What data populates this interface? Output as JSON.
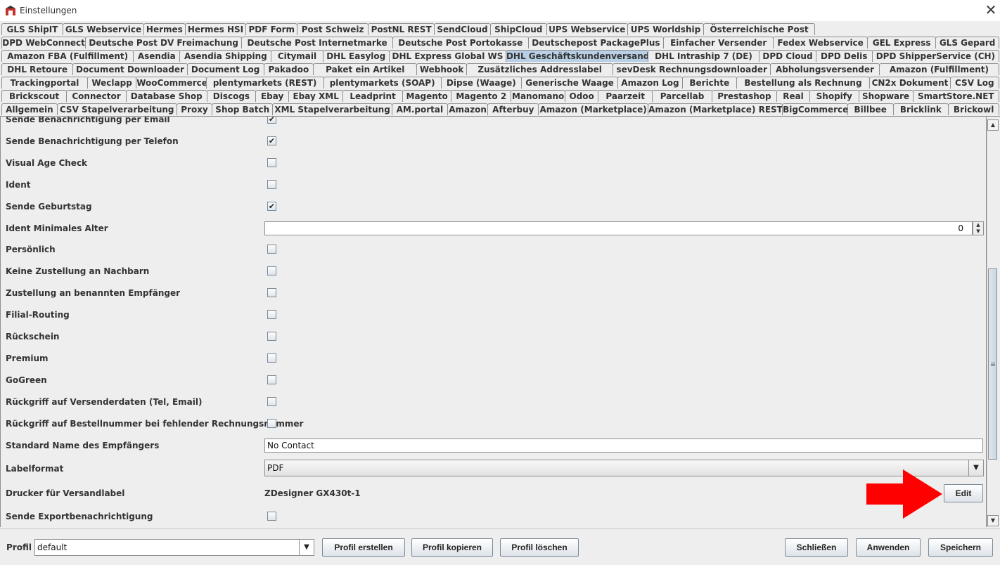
{
  "window": {
    "title": "Einstellungen",
    "close_symbol": "✕",
    "app_icon": "app-icon"
  },
  "tab_rows": [
    [
      "GLS ShipIT",
      "GLS Webservice",
      "Hermes",
      "Hermes HSI",
      "PDF Form",
      "Post Schweiz",
      "PostNL REST",
      "SendCloud",
      "ShipCloud",
      "UPS Webservice",
      "UPS Worldship",
      "Österreichische Post"
    ],
    [
      "DPD WebConnect",
      "Deutsche Post DV Freimachung",
      "Deutsche Post Internetmarke",
      "Deutsche Post Portokasse",
      "Deutschepost PackagePlus",
      "Einfacher Versender",
      "Fedex Webservice",
      "GEL Express",
      "GLS Gepard"
    ],
    [
      "Amazon FBA (Fulfillment)",
      "Asendia",
      "Asendia Shipping",
      "Citymail",
      "DHL Easylog",
      "DHL Express Global WS",
      "DHL Geschäftskundenversand",
      "DHL Intraship 7 (DE)",
      "DPD Cloud",
      "DPD Delis",
      "DPD ShipperService (CH)"
    ],
    [
      "DHL Retoure",
      "Document Downloader",
      "Document Log",
      "Pakadoo",
      "Paket ein Artikel",
      "Webhook",
      "Zusätzliches Addresslabel",
      "sevDesk Rechnungsdownloader",
      "Abholungsversender",
      "Amazon (Fulfillment)"
    ],
    [
      "Trackingportal",
      "Weclapp",
      "WooCommerce",
      "plentymarkets (REST)",
      "plentymarkets (SOAP)",
      "Dipse (Waage)",
      "Generische Waage",
      "Amazon Log",
      "Berichte",
      "Bestellung als Rechnung",
      "CN2x Dokument",
      "CSV Log"
    ],
    [
      "Brickscout",
      "Connector",
      "Database Shop",
      "Discogs",
      "Ebay",
      "Ebay XML",
      "Leadprint",
      "Magento",
      "Magento 2",
      "Manomano",
      "Odoo",
      "Paarzeit",
      "Parcellab",
      "Prestashop",
      "Real",
      "Shopify",
      "Shopware",
      "SmartStore.NET"
    ],
    [
      "Allgemein",
      "CSV Stapelverarbeitung",
      "Proxy",
      "Shop Batch",
      "XML Stapelverarbeitung",
      "AM.portal",
      "Amazon",
      "Afterbuy",
      "Amazon (Marketplace)",
      "Amazon (Marketplace) REST",
      "BigCommerce",
      "Billbee",
      "Bricklink",
      "Brickowl"
    ]
  ],
  "selected_tab": "DHL Geschäftskundenversand",
  "settings": {
    "partial_top": {
      "label": "Sende Benachrichtigung per Email",
      "checked": "✔"
    },
    "sende_telefon": {
      "label": "Sende Benachrichtigung per Telefon",
      "checked": "✔"
    },
    "visual_age_check": {
      "label": "Visual Age Check",
      "checked": ""
    },
    "ident": {
      "label": "Ident",
      "checked": ""
    },
    "sende_geburtstag": {
      "label": "Sende Geburtstag",
      "checked": "✔"
    },
    "ident_min_alter": {
      "label": "Ident Minimales Alter",
      "value": "0"
    },
    "persoenlich": {
      "label": "Persönlich",
      "checked": ""
    },
    "keine_zustellung": {
      "label": "Keine Zustellung an Nachbarn",
      "checked": ""
    },
    "zustellung_benannt": {
      "label": "Zustellung an benannten Empfänger",
      "checked": ""
    },
    "filial_routing": {
      "label": "Filial-Routing",
      "checked": ""
    },
    "rueckschein": {
      "label": "Rückschein",
      "checked": ""
    },
    "premium": {
      "label": "Premium",
      "checked": ""
    },
    "gogreen": {
      "label": "GoGreen",
      "checked": ""
    },
    "rueckgriff_versender": {
      "label": "Rückgriff auf Versenderdaten (Tel, Email)",
      "checked": ""
    },
    "rueckgriff_bestellnummer": {
      "label": "Rückgriff auf Bestellnummer bei fehlender Rechnungsnummer",
      "checked": ""
    },
    "standard_name": {
      "label": "Standard Name des Empfängers",
      "value": "No Contact"
    },
    "labelformat": {
      "label": "Labelformat",
      "value": "PDF"
    },
    "drucker": {
      "label": "Drucker für Versandlabel",
      "value": "ZDesigner GX430t-1",
      "button": "Edit"
    },
    "sende_export": {
      "label": "Sende Exportbenachrichtigung",
      "checked": ""
    }
  },
  "bottom": {
    "profil_label": "Profil",
    "profil_value": "default",
    "buttons": {
      "create": "Profil erstellen",
      "copy": "Profil kopieren",
      "delete": "Profil löschen",
      "close": "Schließen",
      "apply": "Anwenden",
      "save": "Speichern"
    }
  },
  "colors": {
    "selected_tab": "#b8cfe5",
    "annotation_arrow": "#ff0000"
  }
}
